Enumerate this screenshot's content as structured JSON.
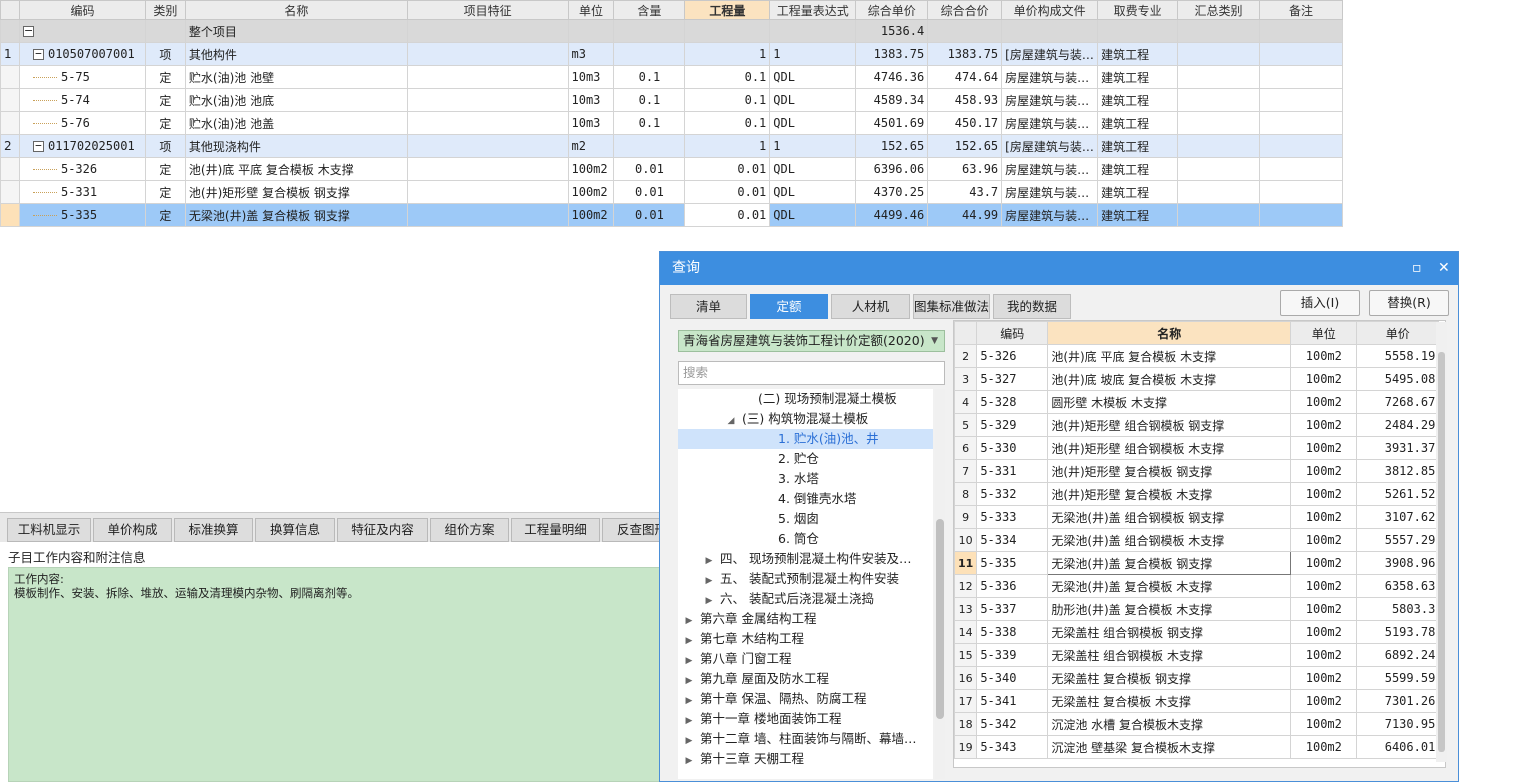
{
  "main": {
    "columns": [
      "编码",
      "类别",
      "名称",
      "项目特征",
      "单位",
      "含量",
      "工程量",
      "工程量表达式",
      "综合单价",
      "综合合价",
      "单价构成文件",
      "取费专业",
      "汇总类别",
      "备注"
    ],
    "total": {
      "label": "整个项目",
      "amount": "1536.4"
    },
    "rows": [
      {
        "idx": "1",
        "type": "parent",
        "code": "010507007001",
        "cat": "项",
        "name": "其他构件",
        "unit": "m3",
        "qty_rate": "",
        "qty": "1",
        "expr": "1",
        "price": "1383.75",
        "total": "1383.75",
        "file": "[房屋建筑与装…",
        "major": "建筑工程"
      },
      {
        "idx": "",
        "type": "child",
        "code": "5-75",
        "cat": "定",
        "name": "贮水(油)池 池壁",
        "unit": "10m3",
        "qty_rate": "0.1",
        "qty": "0.1",
        "expr": "QDL",
        "price": "4746.36",
        "total": "474.64",
        "file": "房屋建筑与装…",
        "major": "建筑工程"
      },
      {
        "idx": "",
        "type": "child",
        "code": "5-74",
        "cat": "定",
        "name": "贮水(油)池 池底",
        "unit": "10m3",
        "qty_rate": "0.1",
        "qty": "0.1",
        "expr": "QDL",
        "price": "4589.34",
        "total": "458.93",
        "file": "房屋建筑与装…",
        "major": "建筑工程"
      },
      {
        "idx": "",
        "type": "child",
        "code": "5-76",
        "cat": "定",
        "name": "贮水(油)池 池盖",
        "unit": "10m3",
        "qty_rate": "0.1",
        "qty": "0.1",
        "expr": "QDL",
        "price": "4501.69",
        "total": "450.17",
        "file": "房屋建筑与装…",
        "major": "建筑工程"
      },
      {
        "idx": "2",
        "type": "parent",
        "code": "011702025001",
        "cat": "项",
        "name": "其他现浇构件",
        "unit": "m2",
        "qty_rate": "",
        "qty": "1",
        "expr": "1",
        "price": "152.65",
        "total": "152.65",
        "file": "[房屋建筑与装…",
        "major": "建筑工程"
      },
      {
        "idx": "",
        "type": "child",
        "code": "5-326",
        "cat": "定",
        "name": "池(井)底 平底 复合模板 木支撑",
        "unit": "100m2",
        "qty_rate": "0.01",
        "qty": "0.01",
        "expr": "QDL",
        "price": "6396.06",
        "total": "63.96",
        "file": "房屋建筑与装…",
        "major": "建筑工程"
      },
      {
        "idx": "",
        "type": "child",
        "code": "5-331",
        "cat": "定",
        "name": "池(井)矩形壁 复合模板 钢支撑",
        "unit": "100m2",
        "qty_rate": "0.01",
        "qty": "0.01",
        "expr": "QDL",
        "price": "4370.25",
        "total": "43.7",
        "file": "房屋建筑与装…",
        "major": "建筑工程"
      },
      {
        "idx": "",
        "type": "sel",
        "code": "5-335",
        "cat": "定",
        "name": "无梁池(井)盖 复合模板 钢支撑",
        "unit": "100m2",
        "qty_rate": "0.01",
        "qty": "0.01",
        "expr": "QDL",
        "price": "4499.46",
        "total": "44.99",
        "file": "房屋建筑与装…",
        "major": "建筑工程"
      }
    ]
  },
  "bottom_tabs": [
    "工料机显示",
    "单价构成",
    "标准换算",
    "换算信息",
    "特征及内容",
    "组价方案",
    "工程量明细",
    "反查图形"
  ],
  "subinfo_title": "子目工作内容和附注信息",
  "work_label": "工作内容:",
  "work_text": "模板制作、安装、拆除、堆放、运输及清理模内杂物、刷隔离剂等。",
  "dialog": {
    "title": "查询",
    "tabs": [
      "清单",
      "定额",
      "人材机",
      "图集标准做法",
      "我的数据"
    ],
    "active_tab": "定额",
    "insert_btn": "插入(I)",
    "replace_btn": "替换(R)",
    "quota_lib": "青海省房屋建筑与装饰工程计价定额(2020)",
    "search_placeholder": "搜索",
    "tree": [
      {
        "label": "(二) 现场预制混凝土模板",
        "indent": 84,
        "toggle": ""
      },
      {
        "label": "(三) 构筑物混凝土模板",
        "indent": 68,
        "toggle": "◢"
      },
      {
        "label": "1. 贮水(油)池、井",
        "indent": 104,
        "toggle": "",
        "sel": true
      },
      {
        "label": "2. 贮仓",
        "indent": 104,
        "toggle": ""
      },
      {
        "label": "3. 水塔",
        "indent": 104,
        "toggle": ""
      },
      {
        "label": "4. 倒锥壳水塔",
        "indent": 104,
        "toggle": ""
      },
      {
        "label": "5. 烟囱",
        "indent": 104,
        "toggle": ""
      },
      {
        "label": "6. 筒仓",
        "indent": 104,
        "toggle": ""
      },
      {
        "label": "四、 现场预制混凝土构件安装及…",
        "indent": 46,
        "toggle": "▶"
      },
      {
        "label": "五、 装配式预制混凝土构件安装",
        "indent": 46,
        "toggle": "▶"
      },
      {
        "label": "六、 装配式后浇混凝土浇捣",
        "indent": 46,
        "toggle": "▶"
      },
      {
        "label": "第六章 金属结构工程",
        "indent": 26,
        "toggle": "▶"
      },
      {
        "label": "第七章 木结构工程",
        "indent": 26,
        "toggle": "▶"
      },
      {
        "label": "第八章 门窗工程",
        "indent": 26,
        "toggle": "▶"
      },
      {
        "label": "第九章 屋面及防水工程",
        "indent": 26,
        "toggle": "▶"
      },
      {
        "label": "第十章 保温、隔热、防腐工程",
        "indent": 26,
        "toggle": "▶"
      },
      {
        "label": "第十一章 楼地面装饰工程",
        "indent": 26,
        "toggle": "▶"
      },
      {
        "label": "第十二章 墙、柱面装饰与隔断、幕墙…",
        "indent": 26,
        "toggle": "▶"
      },
      {
        "label": "第十三章 天棚工程",
        "indent": 26,
        "toggle": "▶"
      }
    ],
    "grid_columns": [
      "编码",
      "名称",
      "单位",
      "单价"
    ],
    "grid_rows": [
      {
        "n": "2",
        "code": "5-326",
        "name": "池(井)底 平底 复合模板 木支撑",
        "unit": "100m2",
        "price": "5558.19"
      },
      {
        "n": "3",
        "code": "5-327",
        "name": "池(井)底 坡底 复合模板 木支撑",
        "unit": "100m2",
        "price": "5495.08"
      },
      {
        "n": "4",
        "code": "5-328",
        "name": "圆形壁 木模板 木支撑",
        "unit": "100m2",
        "price": "7268.67"
      },
      {
        "n": "5",
        "code": "5-329",
        "name": "池(井)矩形壁 组合钢模板 钢支撑",
        "unit": "100m2",
        "price": "2484.29"
      },
      {
        "n": "6",
        "code": "5-330",
        "name": "池(井)矩形壁 组合钢模板 木支撑",
        "unit": "100m2",
        "price": "3931.37"
      },
      {
        "n": "7",
        "code": "5-331",
        "name": "池(井)矩形壁 复合模板 钢支撑",
        "unit": "100m2",
        "price": "3812.85"
      },
      {
        "n": "8",
        "code": "5-332",
        "name": "池(井)矩形壁 复合模板 木支撑",
        "unit": "100m2",
        "price": "5261.52"
      },
      {
        "n": "9",
        "code": "5-333",
        "name": "无梁池(井)盖 组合钢模板 钢支撑",
        "unit": "100m2",
        "price": "3107.62"
      },
      {
        "n": "10",
        "code": "5-334",
        "name": "无梁池(井)盖 组合钢模板 木支撑",
        "unit": "100m2",
        "price": "5557.29"
      },
      {
        "n": "11",
        "code": "5-335",
        "name": "无梁池(井)盖 复合模板 钢支撑",
        "unit": "100m2",
        "price": "3908.96",
        "sel": true
      },
      {
        "n": "12",
        "code": "5-336",
        "name": "无梁池(井)盖 复合模板 木支撑",
        "unit": "100m2",
        "price": "6358.63"
      },
      {
        "n": "13",
        "code": "5-337",
        "name": "肋形池(井)盖 复合模板 木支撑",
        "unit": "100m2",
        "price": "5803.3"
      },
      {
        "n": "14",
        "code": "5-338",
        "name": "无梁盖柱 组合钢模板 钢支撑",
        "unit": "100m2",
        "price": "5193.78"
      },
      {
        "n": "15",
        "code": "5-339",
        "name": "无梁盖柱 组合钢模板 木支撑",
        "unit": "100m2",
        "price": "6892.24"
      },
      {
        "n": "16",
        "code": "5-340",
        "name": "无梁盖柱 复合模板 钢支撑",
        "unit": "100m2",
        "price": "5599.59"
      },
      {
        "n": "17",
        "code": "5-341",
        "name": "无梁盖柱 复合模板 木支撑",
        "unit": "100m2",
        "price": "7301.26"
      },
      {
        "n": "18",
        "code": "5-342",
        "name": "沉淀池 水槽 复合模板木支撑",
        "unit": "100m2",
        "price": "7130.95"
      },
      {
        "n": "19",
        "code": "5-343",
        "name": "沉淀池 壁基梁 复合模板木支撑",
        "unit": "100m2",
        "price": "6406.01"
      }
    ]
  }
}
